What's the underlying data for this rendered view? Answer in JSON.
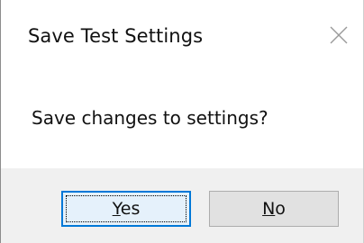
{
  "dialog": {
    "title": "Save Test Settings",
    "close_icon": "close-icon",
    "message": "Save changes to settings?",
    "buttons": {
      "yes": {
        "mnemonic": "Y",
        "rest": "es"
      },
      "no": {
        "mnemonic": "N",
        "rest": "o"
      }
    }
  },
  "colors": {
    "footer_background": "#f0f0f0",
    "focused_button_border": "#0078d7",
    "button_background": "#e1e1e1"
  }
}
